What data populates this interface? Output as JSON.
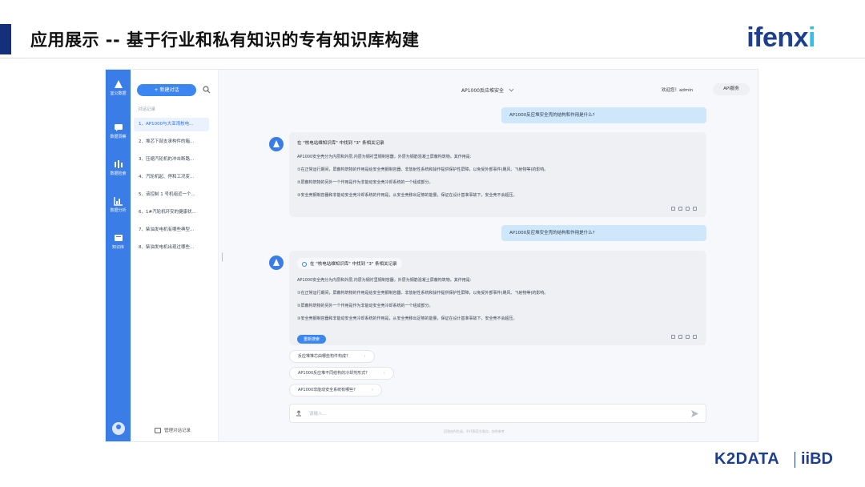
{
  "slide": {
    "title": "应用展示 -- 基于行业和私有知识的专有知识库构建",
    "brand_main": "ifenx",
    "brand_tail": "i",
    "footer_logo_left": "K2DATA",
    "footer_logo_right": "iiBD"
  },
  "rail": {
    "items": [
      {
        "label": "宜公数据",
        "icon": "triangle-logo-icon"
      },
      {
        "label": "数据洞察",
        "icon": "chat-icon"
      },
      {
        "label": "数据检索",
        "icon": "bar-icon"
      },
      {
        "label": "数据分析",
        "icon": "chart-icon"
      },
      {
        "label": "知识库",
        "icon": "book-icon"
      }
    ]
  },
  "sidebar": {
    "new_chat": "+ 新建对话",
    "section": "对话记录",
    "history": [
      "1、AP1000与大亚湾核电...",
      "2、堆芯下部支承构件的箱...",
      "3、压缩汽轮机的冲击断路...",
      "4、汽轮机起、停和工况变...",
      "5、该控制 1 号机组近一个...",
      "6、1#汽轮机环安的健康状...",
      "7、柴油发电机有哪些典型...",
      "8、柴油发电机出现过哪些..."
    ],
    "manage": "管理对话记录"
  },
  "topbar": {
    "title": "AP1000反应堆安全",
    "welcome": "欢迎您！admin",
    "api": "API服务"
  },
  "chat": {
    "q1": "AP1000反应堆安全壳的结构和作用是什么?",
    "a1": {
      "found": "在 \"核电站维知识库\" 中找到 \"3\" 条相关记录",
      "lines": [
        "AP1000安全壳分为内层和外层,内层为钢衬里钢制容器，外层为钢筋混凝土屏蔽构筑物。其作用是:",
        "①在正常运行期间，屏蔽构筑物的作用是给安全壳钢制容器、非放射性系统和操作提供保护性屏障，以免受外部事件(飓风、飞射物等)的影响。",
        "②屏蔽构筑物的另外一个作用是作为非能动安全壳冷却系统的一个组成部分。",
        "③安全壳钢制容器和非能动安全壳冷却系统的作用是，从安全壳移出足够的能量，保证在设计基准事故下，安全壳不会超压。"
      ]
    },
    "q2": "AP1000反应堆安全壳的结构和作用是什么?",
    "a2": {
      "found": "在 \"核电站维知识库\" 中找到 \"3\" 条相关记录",
      "lines": [
        "AP1000安全壳分为内层和外层,内层为钢衬里钢制容器，外层为钢筋混凝土屏蔽构筑物。其作用是:",
        "①在正常运行期间，屏蔽构筑物的作用是给安全壳钢制容器、非放射性系统和操作提供保护性屏障，以免受外部事件(飓风、飞射物等)的影响。",
        "②屏蔽构筑物的另外一个作用是作为非能动安全壳冷却系统的一个组成部分。",
        "③安全壳钢制容器和非能动安全壳冷却系统的作用是，从安全壳移出足够的能量，保证在设计基准事故下，安全壳不会超压。"
      ],
      "regen": "重新搜索"
    },
    "suggestions": [
      "反应堆堆芯由哪些构件构成?",
      "AP1000反应堆不同结构的冷却剂形式?",
      "AP1000非能动安全系统有哪些?"
    ],
    "input_placeholder": "请输入...",
    "disclaimer": "回答由AI生成，不代表官方观点，仅供参考"
  },
  "colors": {
    "rail": "#3b7de6",
    "accent": "#3b86f0",
    "user_bubble": "#cfe7fb",
    "brand": "#1d3f8e"
  }
}
